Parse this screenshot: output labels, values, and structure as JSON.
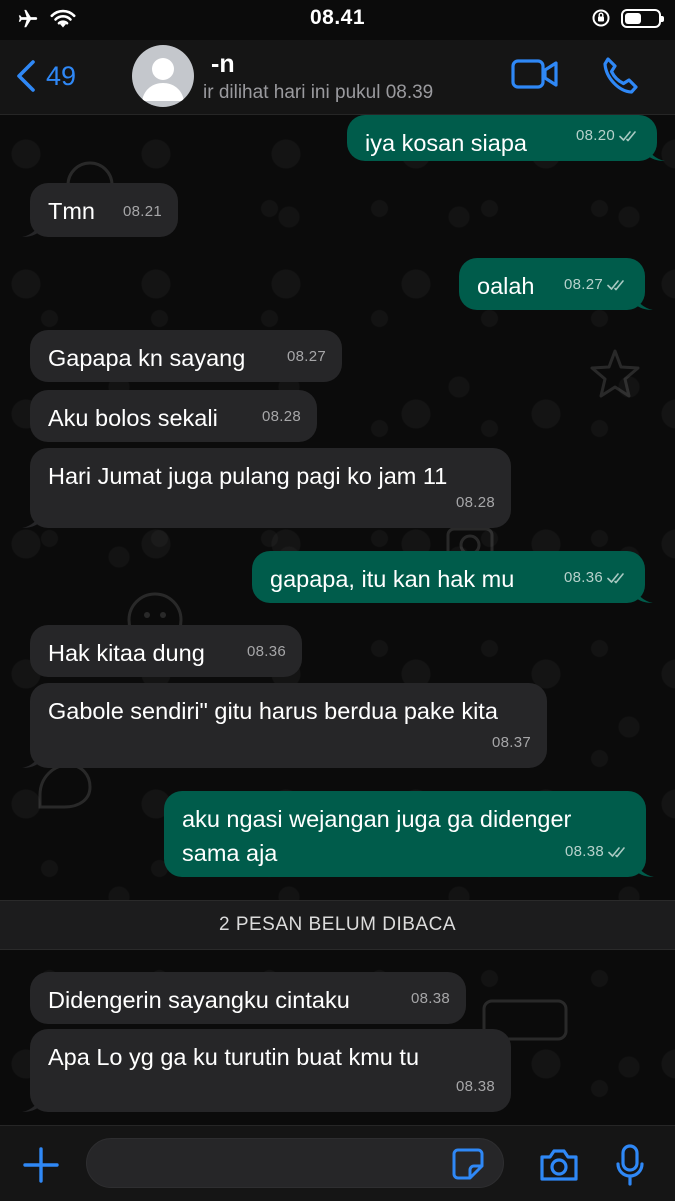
{
  "status_bar": {
    "time": "08.41",
    "battery_level": 0.5
  },
  "header": {
    "back_count": "49",
    "contact_name": "-n",
    "last_seen": "ir dilihat hari ini pukul 08.39"
  },
  "messages": [
    {
      "dir": "out",
      "text": "iya kosan siapa",
      "time": "08.20",
      "read": true
    },
    {
      "dir": "in",
      "text": "Tmn",
      "time": "08.21"
    },
    {
      "dir": "out",
      "text": "oalah",
      "time": "08.27",
      "read": true
    },
    {
      "dir": "in",
      "text": "Gapapa kn sayang",
      "time": "08.27"
    },
    {
      "dir": "in",
      "text": "Aku bolos sekali",
      "time": "08.28"
    },
    {
      "dir": "in",
      "text": "Hari Jumat juga pulang pagi ko jam 11",
      "time": "08.28"
    },
    {
      "dir": "out",
      "text": "gapapa, itu kan hak mu",
      "time": "08.36",
      "read": true
    },
    {
      "dir": "in",
      "text": "Hak kitaa dung",
      "time": "08.36"
    },
    {
      "dir": "in",
      "text": "Gabole sendiri\" gitu harus berdua pake kita",
      "time": "08.37"
    },
    {
      "dir": "out",
      "text": "aku ngasi wejangan juga ga didenger sama aja",
      "time": "08.38",
      "read": true
    },
    {
      "dir": "in",
      "text": "Didengerin sayangku cintaku",
      "time": "08.38"
    },
    {
      "dir": "in",
      "text": "Apa Lo yg ga ku turutin buat kmu tu",
      "time": "08.38"
    }
  ],
  "unread_banner": "2 PESAN BELUM DIBACA",
  "input": {
    "placeholder": "",
    "value": ""
  },
  "icons": {
    "back": "chevron-left-icon",
    "video": "video-camera-icon",
    "call": "phone-icon",
    "plus": "plus-icon",
    "sticker": "sticker-icon",
    "camera": "camera-icon",
    "mic": "microphone-icon"
  },
  "colors": {
    "accent": "#2f88f6",
    "outgoing_bubble": "#005c4b",
    "incoming_bubble": "#262628",
    "background": "#0b0b0b",
    "bar": "#151515",
    "read_ticks": "#a9c9c2"
  }
}
